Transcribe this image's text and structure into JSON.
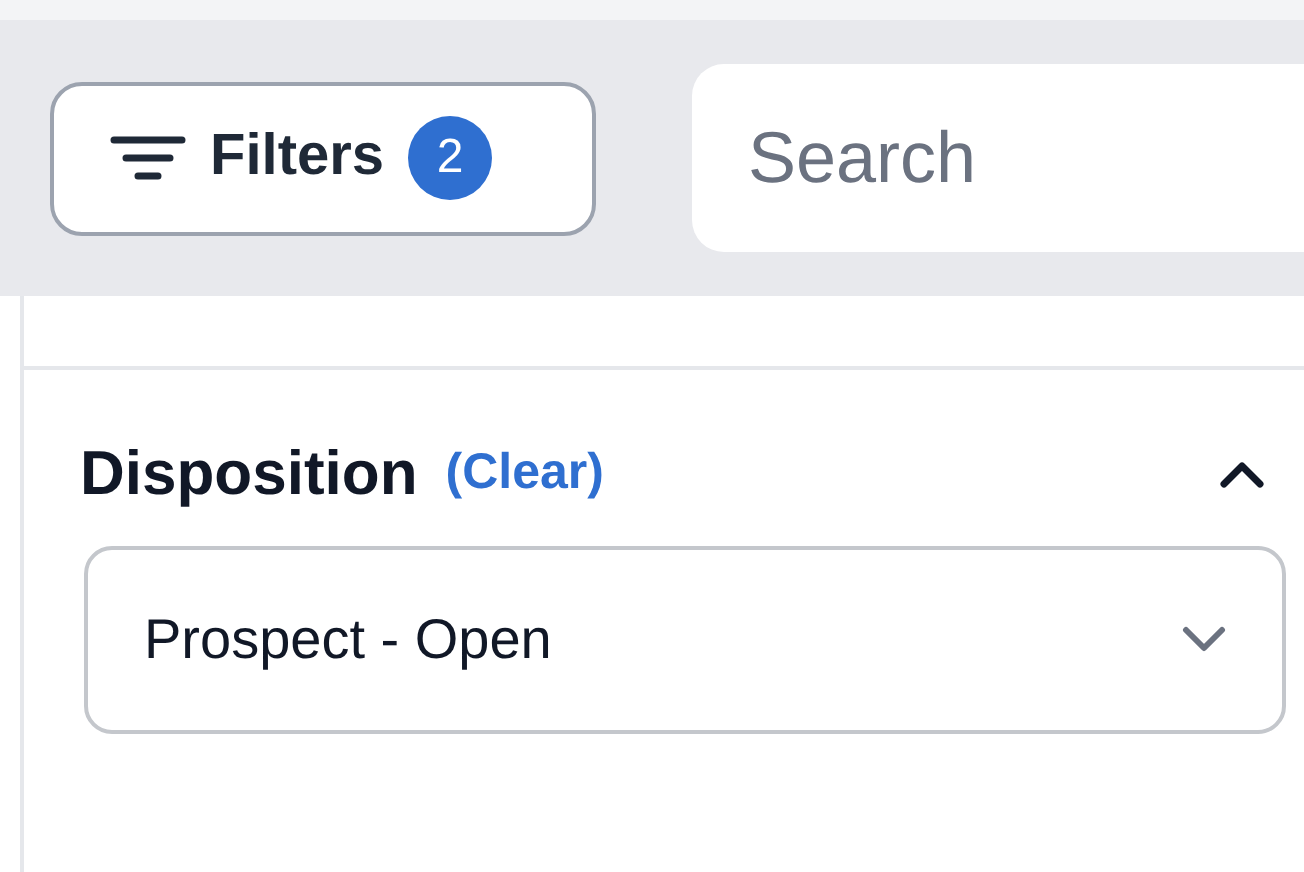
{
  "toolbar": {
    "filters_button": {
      "label": "Filters",
      "count": "2"
    },
    "search": {
      "placeholder": "Search"
    }
  },
  "filter_section": {
    "title": "Disposition",
    "clear_link": "(Clear)",
    "expanded": true,
    "select": {
      "value": "Prospect - Open"
    }
  }
}
